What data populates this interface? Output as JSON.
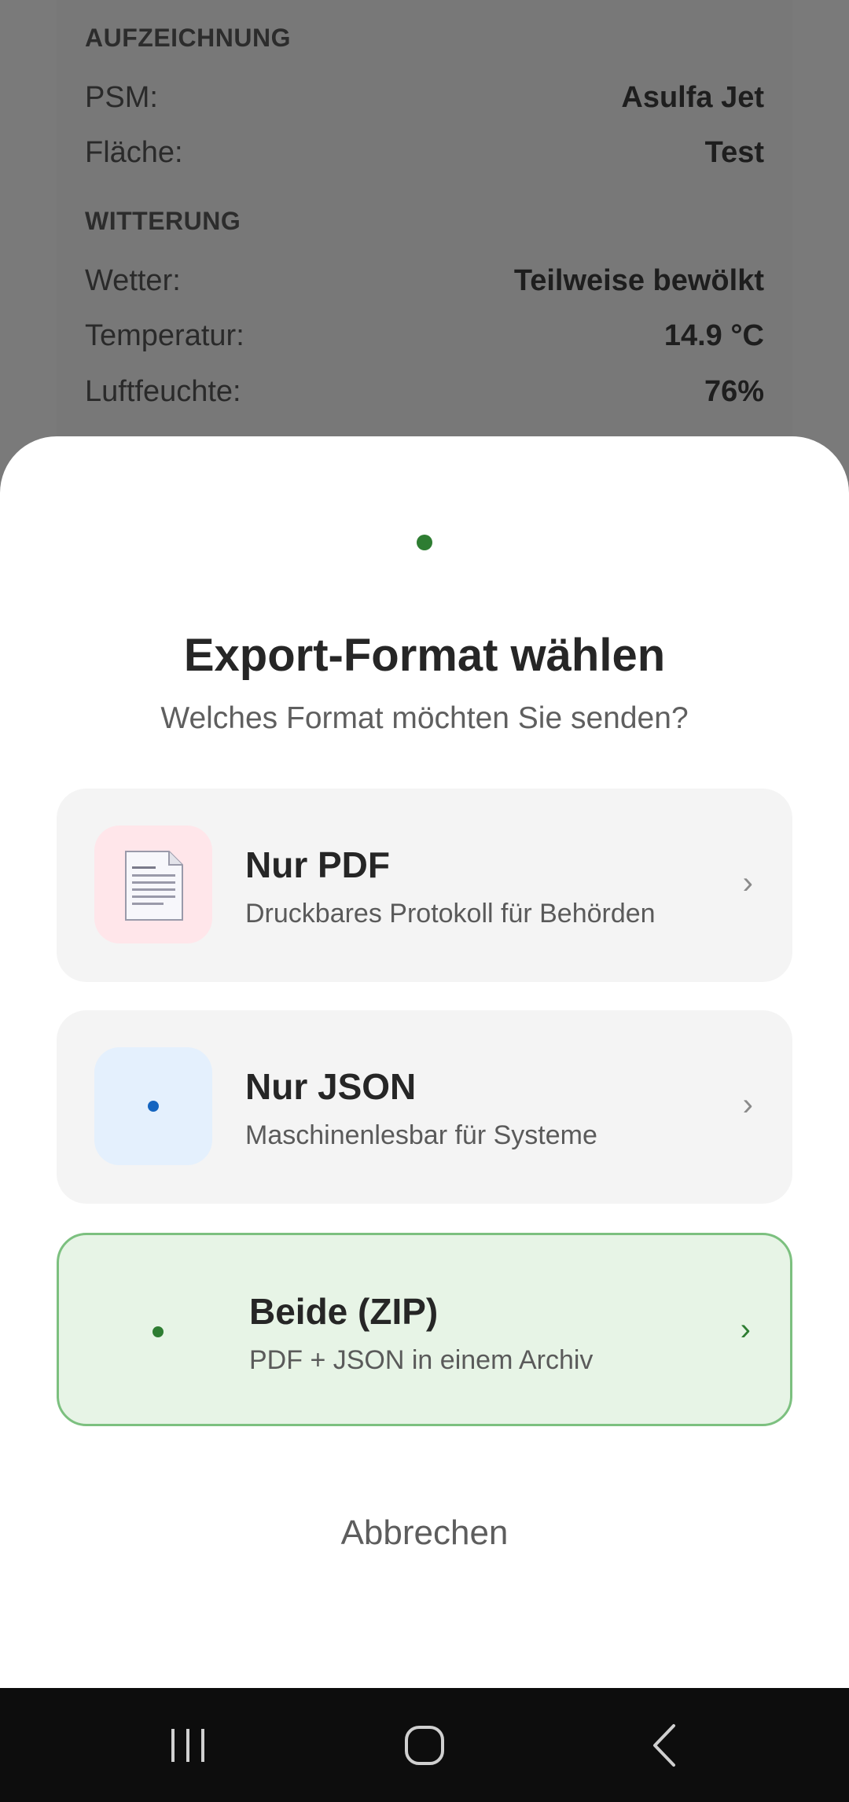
{
  "background": {
    "section_recording": "AUFZEICHNUNG",
    "rows_recording": [
      {
        "label": "PSM:",
        "value": "Asulfa Jet"
      },
      {
        "label": "Fläche:",
        "value": "Test"
      }
    ],
    "section_weather": "WITTERUNG",
    "rows_weather": [
      {
        "label": "Wetter:",
        "value": "Teilweise bewölkt"
      },
      {
        "label": "Temperatur:",
        "value": "14.9 °C"
      },
      {
        "label": "Luftfeuchte:",
        "value": "76%"
      }
    ]
  },
  "sheet": {
    "title": "Export-Format wählen",
    "subtitle": "Welches Format möchten Sie senden?",
    "options": [
      {
        "title": "Nur PDF",
        "desc": "Druckbares Protokoll für Behörden",
        "icon": "document-icon"
      },
      {
        "title": "Nur JSON",
        "desc": "Maschinenlesbar für Systeme",
        "icon": "blue-dot-icon"
      },
      {
        "title": "Beide (ZIP)",
        "desc": "PDF + JSON in einem Archiv",
        "icon": "green-dot-icon"
      }
    ],
    "chevron": "›",
    "cancel_label": "Abbrechen"
  },
  "colors": {
    "accent_green": "#2e7d32",
    "json_blue": "#1565c0",
    "pdf_bg": "#ffe6ea",
    "json_bg": "#e4f0fd",
    "zip_bg": "#e7f4e6"
  }
}
